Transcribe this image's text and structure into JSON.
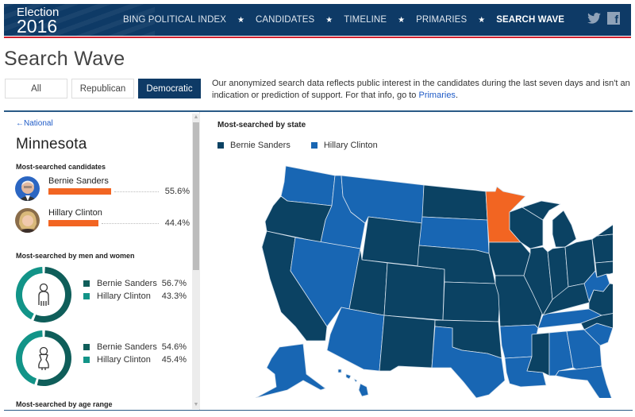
{
  "header": {
    "logo_line1": "Election",
    "logo_line2": "2016",
    "nav": [
      {
        "label": "BING POLITICAL INDEX",
        "active": false
      },
      {
        "label": "CANDIDATES",
        "active": false
      },
      {
        "label": "TIMELINE",
        "active": false
      },
      {
        "label": "PRIMARIES",
        "active": false
      },
      {
        "label": "SEARCH WAVE",
        "active": true
      }
    ],
    "nav_separator": "★",
    "social": [
      {
        "name": "twitter",
        "glyph": "🐦"
      },
      {
        "name": "facebook",
        "glyph": "f"
      }
    ]
  },
  "page": {
    "title": "Search Wave",
    "tabs": [
      {
        "label": "All",
        "selected": false
      },
      {
        "label": "Republican",
        "selected": false
      },
      {
        "label": "Democratic",
        "selected": true
      }
    ],
    "intro_text": "Our anonymized search data reflects public interest in the candidates during the last seven days and isn't an indication or prediction of support. For that info, go to ",
    "intro_link": "Primaries",
    "intro_end": "."
  },
  "left_panel": {
    "back_label": "National",
    "back_icon": "←",
    "state": "Minnesota",
    "most_searched_heading": "Most-searched candidates",
    "candidates": [
      {
        "name": "Bernie Sanders",
        "percent": 55.6,
        "percent_label": "55.6%"
      },
      {
        "name": "Hillary Clinton",
        "percent": 44.4,
        "percent_label": "44.4%"
      }
    ],
    "gender_heading": "Most-searched by men and women",
    "gender": [
      {
        "group": "men",
        "icon": "male-icon",
        "rows": [
          {
            "name": "Bernie Sanders",
            "percent": 56.7,
            "label": "56.7%"
          },
          {
            "name": "Hillary Clinton",
            "percent": 43.3,
            "label": "43.3%"
          }
        ]
      },
      {
        "group": "women",
        "icon": "female-icon",
        "rows": [
          {
            "name": "Bernie Sanders",
            "percent": 54.6,
            "label": "54.6%"
          },
          {
            "name": "Hillary Clinton",
            "percent": 45.4,
            "label": "45.4%"
          }
        ]
      }
    ],
    "age_heading": "Most-searched by age range"
  },
  "map": {
    "title": "Most-searched by state",
    "legend": [
      {
        "name": "Bernie Sanders",
        "color": "#0b4263"
      },
      {
        "name": "Hillary Clinton",
        "color": "#1866b3"
      }
    ],
    "selected_state": "MN",
    "selected_color": "#f26522",
    "clinton_states": [
      "WA",
      "ID",
      "MT",
      "NV",
      "AZ",
      "SD",
      "TX",
      "AR",
      "LA",
      "TN",
      "AL",
      "GA",
      "SC",
      "FL",
      "WV",
      "NJ",
      "AK",
      "HI"
    ],
    "sanders_states": [
      "OR",
      "CA",
      "WY",
      "UT",
      "CO",
      "NM",
      "ND",
      "NE",
      "KS",
      "OK",
      "IA",
      "MO",
      "WI",
      "IL",
      "MI",
      "IN",
      "OH",
      "KY",
      "MS",
      "NC",
      "VA",
      "PA",
      "NY",
      "MD",
      "DE",
      "CT",
      "RI",
      "MA",
      "VT",
      "NH",
      "ME"
    ]
  },
  "colors": {
    "brand": "#0e3a66",
    "accent_red": "#cf1f2e",
    "bar_orange": "#f26522",
    "donut_sanders": "#0f5e5a",
    "donut_clinton": "#129488",
    "link": "#1f5bc7"
  }
}
